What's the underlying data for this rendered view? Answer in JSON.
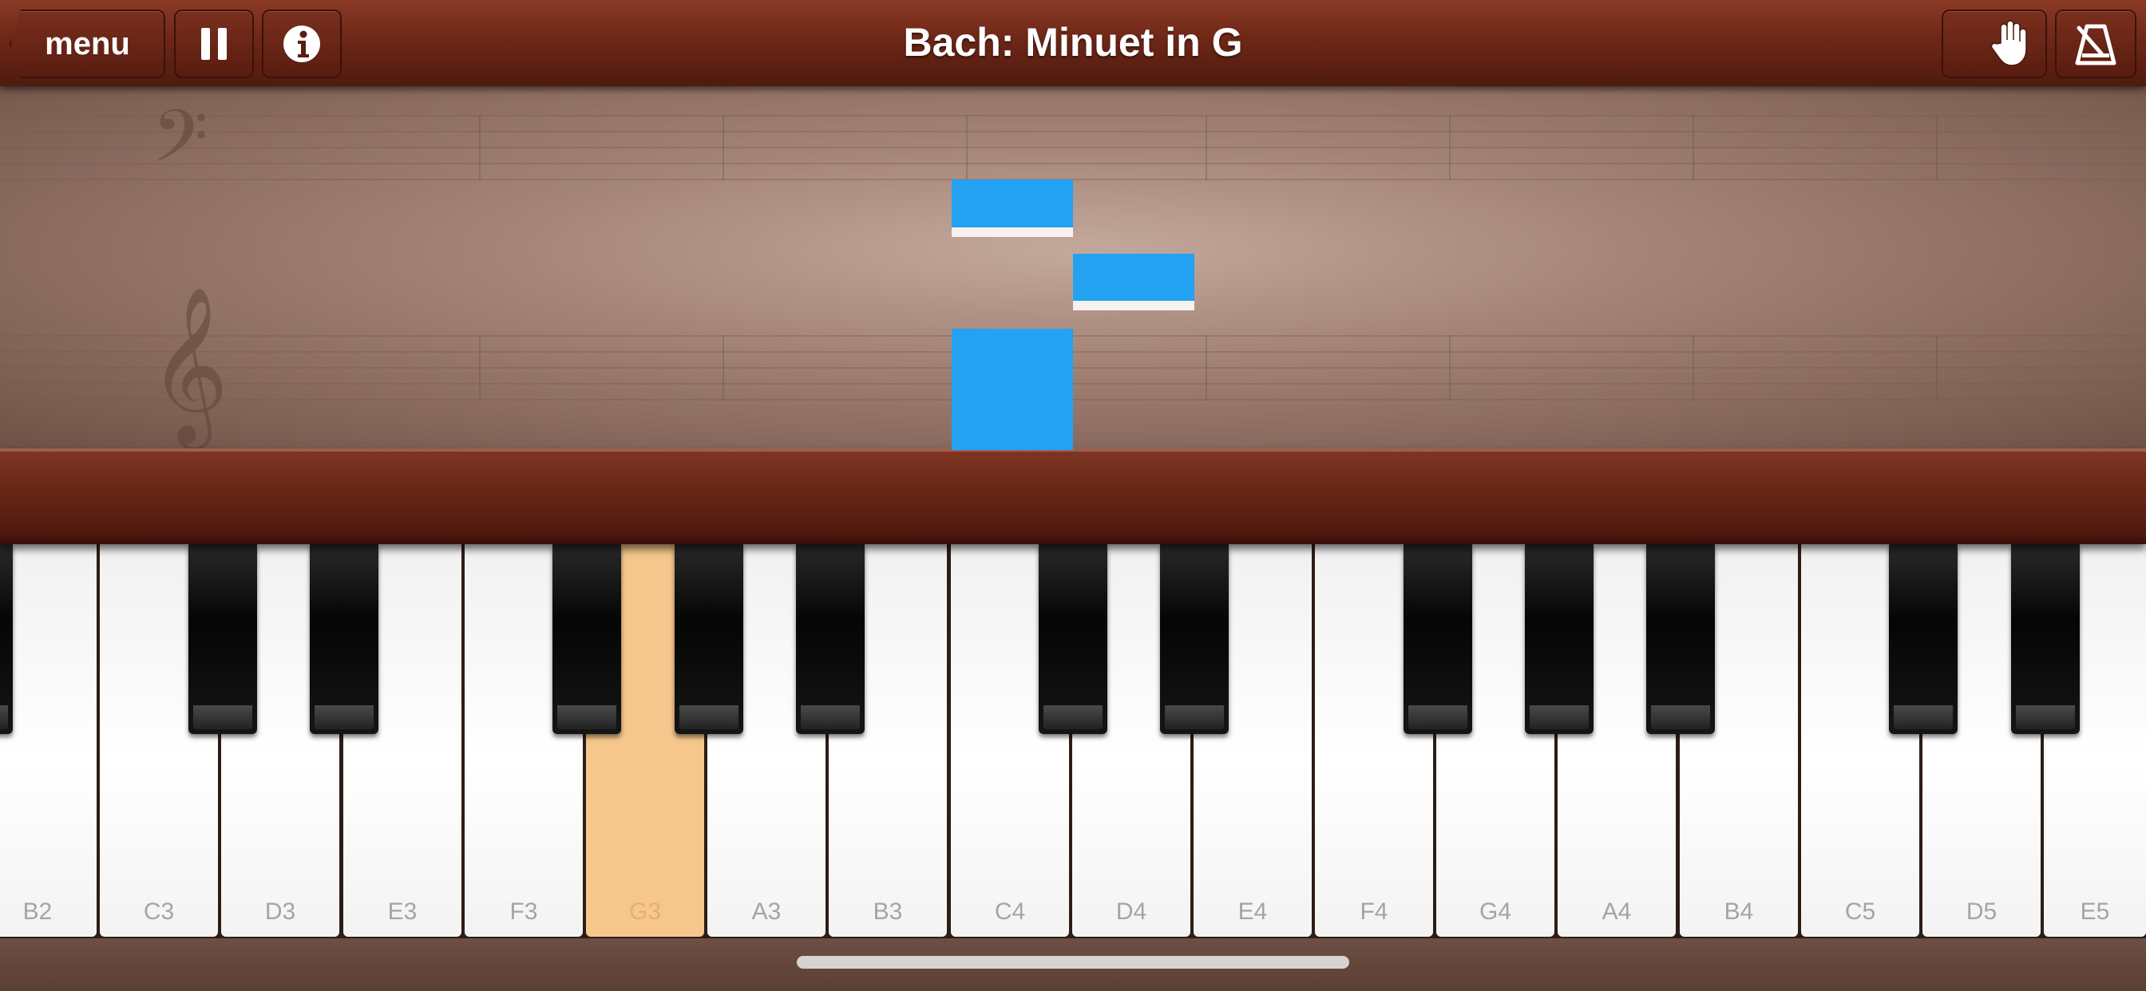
{
  "topbar": {
    "menu_label": "menu",
    "title": "Bach: Minuet in G",
    "buttons": [
      "pause-icon",
      "info-icon",
      "hand-icon",
      "metronome-icon"
    ]
  },
  "keyboard": {
    "white_keys": [
      "B2",
      "C3",
      "D3",
      "E3",
      "F3",
      "G3",
      "A3",
      "B3",
      "C4",
      "D4",
      "E4",
      "F4",
      "G4",
      "A4",
      "B4",
      "C5",
      "D5",
      "E5"
    ],
    "active_key": "G3",
    "active_color": "#f6c78c"
  },
  "falling_notes": {
    "color": "#23a2f2",
    "count": 3
  }
}
